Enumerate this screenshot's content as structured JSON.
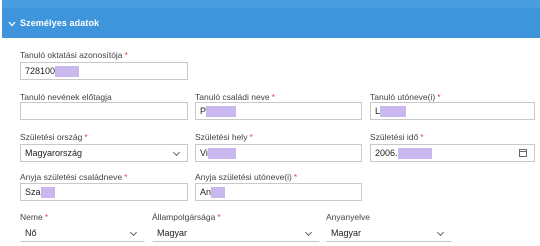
{
  "panel": {
    "title": "Személyes adatok",
    "collapse_icon": "chevron-down-icon"
  },
  "required_marker": "*",
  "fields": {
    "oktatasi_azonosito": {
      "label": "Tanuló oktatási azonosítója",
      "value": "728100"
    },
    "nev_elotag": {
      "label": "Tanuló nevének előtagja",
      "value": ""
    },
    "csaladi_nev": {
      "label": "Tanuló családi neve",
      "value": "P"
    },
    "utonev": {
      "label": "Tanuló utóneve(i)",
      "value": "L"
    },
    "szuletesi_orszag": {
      "label": "Születési ország",
      "value": "Magyarország"
    },
    "szuletesi_hely": {
      "label": "Születési hely",
      "value": "Vi"
    },
    "szuletesi_ido": {
      "label": "Születési idő",
      "value": "2006."
    },
    "anyja_csaladi_nev": {
      "label": "Anyja születési családneve",
      "value": "Sza"
    },
    "anyja_utonev": {
      "label": "Anyja születési utóneve(i)",
      "value": "An"
    },
    "neme": {
      "label": "Neme",
      "value": "Nő"
    },
    "allampolgarsag": {
      "label": "Állampolgársága",
      "value": "Magyar"
    },
    "anyanyelv": {
      "label": "Anyanyelve",
      "value": "Magyar"
    }
  },
  "icons": {
    "dropdown": "chevron-down-icon",
    "date": "calendar-icon"
  },
  "colors": {
    "header": "#3e95dc",
    "required": "#e2463d",
    "redaction": "#c9b8ee"
  }
}
